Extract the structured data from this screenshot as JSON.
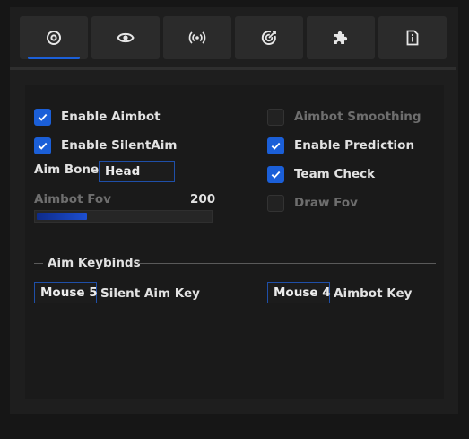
{
  "tabs": [
    {
      "name": "aim",
      "icon": "crosshair-icon",
      "active": true
    },
    {
      "name": "visuals",
      "icon": "eye-icon",
      "active": false
    },
    {
      "name": "network",
      "icon": "broadcast-icon",
      "active": false
    },
    {
      "name": "target",
      "icon": "target-icon",
      "active": false
    },
    {
      "name": "misc",
      "icon": "puzzle-icon",
      "active": false
    },
    {
      "name": "info",
      "icon": "document-info-icon",
      "active": false
    }
  ],
  "accent_color": "#1b5fd8",
  "left": {
    "enable_aimbot": {
      "label": "Enable Aimbot",
      "checked": true
    },
    "enable_silentaim": {
      "label": "Enable SilentAim",
      "checked": true
    },
    "aim_bone_label": "Aim Bone",
    "aim_bone_value": "Head",
    "fov_label": "Aimbot Fov",
    "fov_value": "200",
    "fov_fraction": 0.29
  },
  "right": {
    "aimbot_smoothing": {
      "label": "Aimbot Smoothing",
      "checked": false
    },
    "enable_prediction": {
      "label": "Enable Prediction",
      "checked": true
    },
    "team_check": {
      "label": "Team Check",
      "checked": true
    },
    "draw_fov": {
      "label": "Draw Fov",
      "checked": false
    }
  },
  "keybinds": {
    "title": "Aim Keybinds",
    "silent_key": "Mouse 5",
    "silent_label": "Silent Aim Key",
    "aimbot_key": "Mouse 4",
    "aimbot_label": "Aimbot Key"
  }
}
